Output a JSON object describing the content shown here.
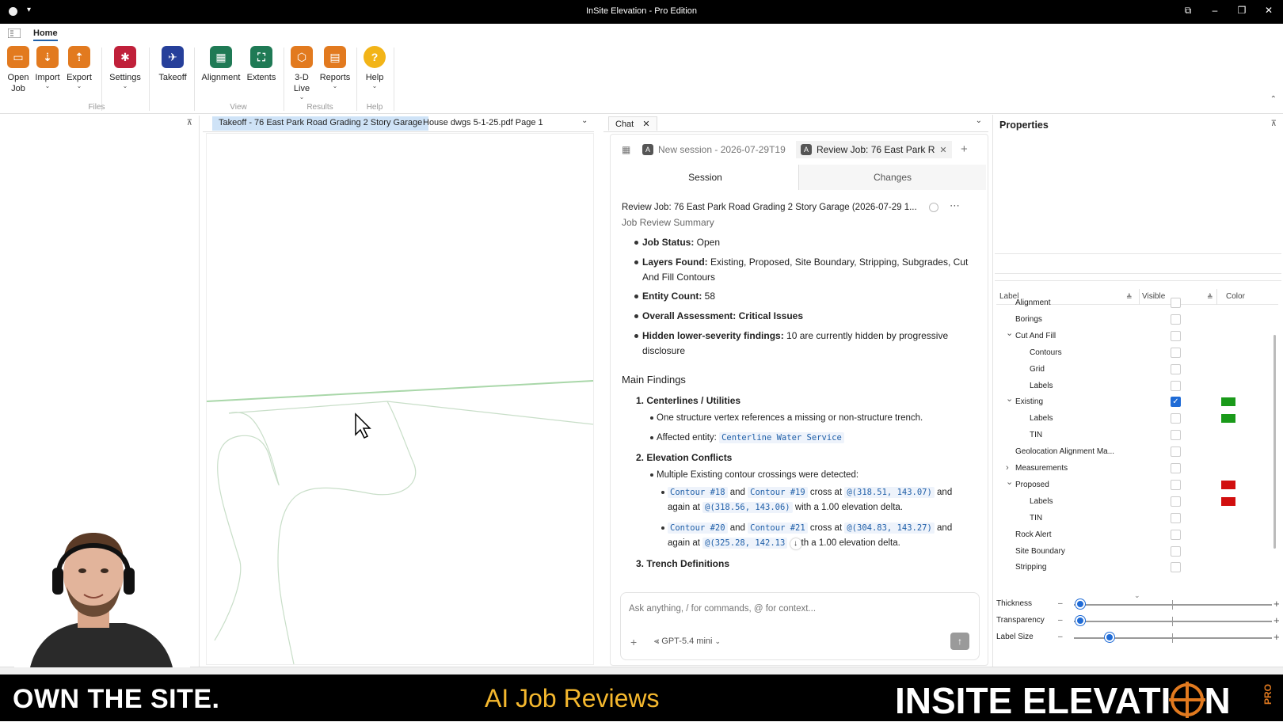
{
  "window": {
    "title": "InSite Elevation - Pro Edition"
  },
  "ribbon": {
    "tab": "Home",
    "buttons": {
      "open_job": "Open Job",
      "import": "Import",
      "export": "Export",
      "settings": "Settings",
      "takeoff": "Takeoff",
      "alignment": "Alignment",
      "extents": "Extents",
      "live3d": "3-D Live",
      "reports": "Reports",
      "help": "Help"
    },
    "groups": {
      "files": "Files",
      "view": "View",
      "results": "Results",
      "help": "Help"
    }
  },
  "doc_tabs": [
    "Takeoff - 76 East Park Road Grading 2 Story Garage",
    "House dwgs 5-1-25.pdf Page 1"
  ],
  "chat": {
    "tab": "Chat",
    "sessions": [
      "New session - 2026-07-29T19",
      "Review Job: 76 East Park R"
    ],
    "subtabs": [
      "Session",
      "Changes"
    ],
    "header": "Review Job: 76 East Park Road Grading 2 Story Garage (2026-07-29 1...",
    "summary_heading": "Job Review Summary",
    "summary": [
      {
        "k": "Job Status:",
        "v": " Open"
      },
      {
        "k": "Layers Found:",
        "v": " Existing, Proposed, Site Boundary, Stripping, Subgrades, Cut And Fill Contours"
      },
      {
        "k": "Entity Count:",
        "v": " 58"
      },
      {
        "k": "Overall Assessment: Critical Issues",
        "v": ""
      },
      {
        "k": "Hidden lower-severity findings:",
        "v": " 10 are currently hidden by progressive disclosure"
      }
    ],
    "main_heading": "Main Findings",
    "f1": {
      "title": "1. Centerlines / Utilities",
      "b1": "One structure vertex references a missing or non-structure trench.",
      "b2": "Affected entity:",
      "chip": "Centerline Water Service"
    },
    "f2": {
      "title": "2. Elevation Conflicts",
      "b1": "Multiple Existing contour crossings were detected:",
      "c1": {
        "a": "Contour #18",
        "and": "and",
        "b": "Contour #19",
        "cross": "cross at",
        "p1": "@(318.51, 143.07)",
        "and2": "and",
        "again": "again at",
        "p2": "@(318.56, 143.06)",
        "tail": "with a 1.00 elevation delta."
      },
      "c2": {
        "a": "Contour #20",
        "and": "and",
        "b": "Contour #21",
        "cross": "cross at",
        "p1": "@(304.83, 143.27)",
        "and2": "and",
        "again": "again at",
        "p2": "@(325.28, 142.13",
        "tail": "th a 1.00 elevation delta."
      }
    },
    "f3": {
      "title": "3. Trench Definitions"
    },
    "input_placeholder": "Ask anything, / for commands, @ for context...",
    "model": "GPT-5.4 mini"
  },
  "properties": {
    "title": "Properties",
    "columns": [
      "Label",
      "Visible",
      "Color"
    ],
    "layers": [
      {
        "label": "Alignment",
        "indent": 1,
        "exp": "",
        "checked": false,
        "color": ""
      },
      {
        "label": "Borings",
        "indent": 1,
        "exp": "",
        "checked": false,
        "color": ""
      },
      {
        "label": "Cut And Fill",
        "indent": 1,
        "exp": "v",
        "checked": false,
        "color": ""
      },
      {
        "label": "Contours",
        "indent": 2,
        "exp": "",
        "checked": false,
        "color": ""
      },
      {
        "label": "Grid",
        "indent": 2,
        "exp": "",
        "checked": false,
        "color": ""
      },
      {
        "label": "Labels",
        "indent": 2,
        "exp": "",
        "checked": false,
        "color": ""
      },
      {
        "label": "Existing",
        "indent": 1,
        "exp": "v",
        "checked": true,
        "color": "#1a9a1a"
      },
      {
        "label": "Labels",
        "indent": 2,
        "exp": "",
        "checked": false,
        "color": "#1a9a1a"
      },
      {
        "label": "TIN",
        "indent": 2,
        "exp": "",
        "checked": false,
        "color": ""
      },
      {
        "label": "Geolocation Alignment Ma...",
        "indent": 1,
        "exp": "",
        "checked": false,
        "color": ""
      },
      {
        "label": "Measurements",
        "indent": 1,
        "exp": ">",
        "checked": false,
        "color": ""
      },
      {
        "label": "Proposed",
        "indent": 1,
        "exp": "v",
        "checked": false,
        "color": "#d10f0f"
      },
      {
        "label": "Labels",
        "indent": 2,
        "exp": "",
        "checked": false,
        "color": "#d10f0f"
      },
      {
        "label": "TIN",
        "indent": 2,
        "exp": "",
        "checked": false,
        "color": ""
      },
      {
        "label": "Rock Alert",
        "indent": 1,
        "exp": "",
        "checked": false,
        "color": ""
      },
      {
        "label": "Site Boundary",
        "indent": 1,
        "exp": "",
        "checked": false,
        "color": ""
      },
      {
        "label": "Stripping",
        "indent": 1,
        "exp": "",
        "checked": false,
        "color": ""
      }
    ],
    "sliders": [
      {
        "label": "Thickness",
        "value": 0.03
      },
      {
        "label": "Transparency",
        "value": 0.03
      },
      {
        "label": "Label Size",
        "value": 0.18
      }
    ]
  },
  "banner": {
    "left": "OWN THE SITE.",
    "center": "AI Job Reviews",
    "right_a": "INSITE ELEVATI",
    "right_b": "N",
    "pro": "PRO"
  },
  "colors": {
    "accent": "#1f6bd6",
    "banner_gold": "#f5b82e",
    "brand_orange": "#e27a1f"
  }
}
